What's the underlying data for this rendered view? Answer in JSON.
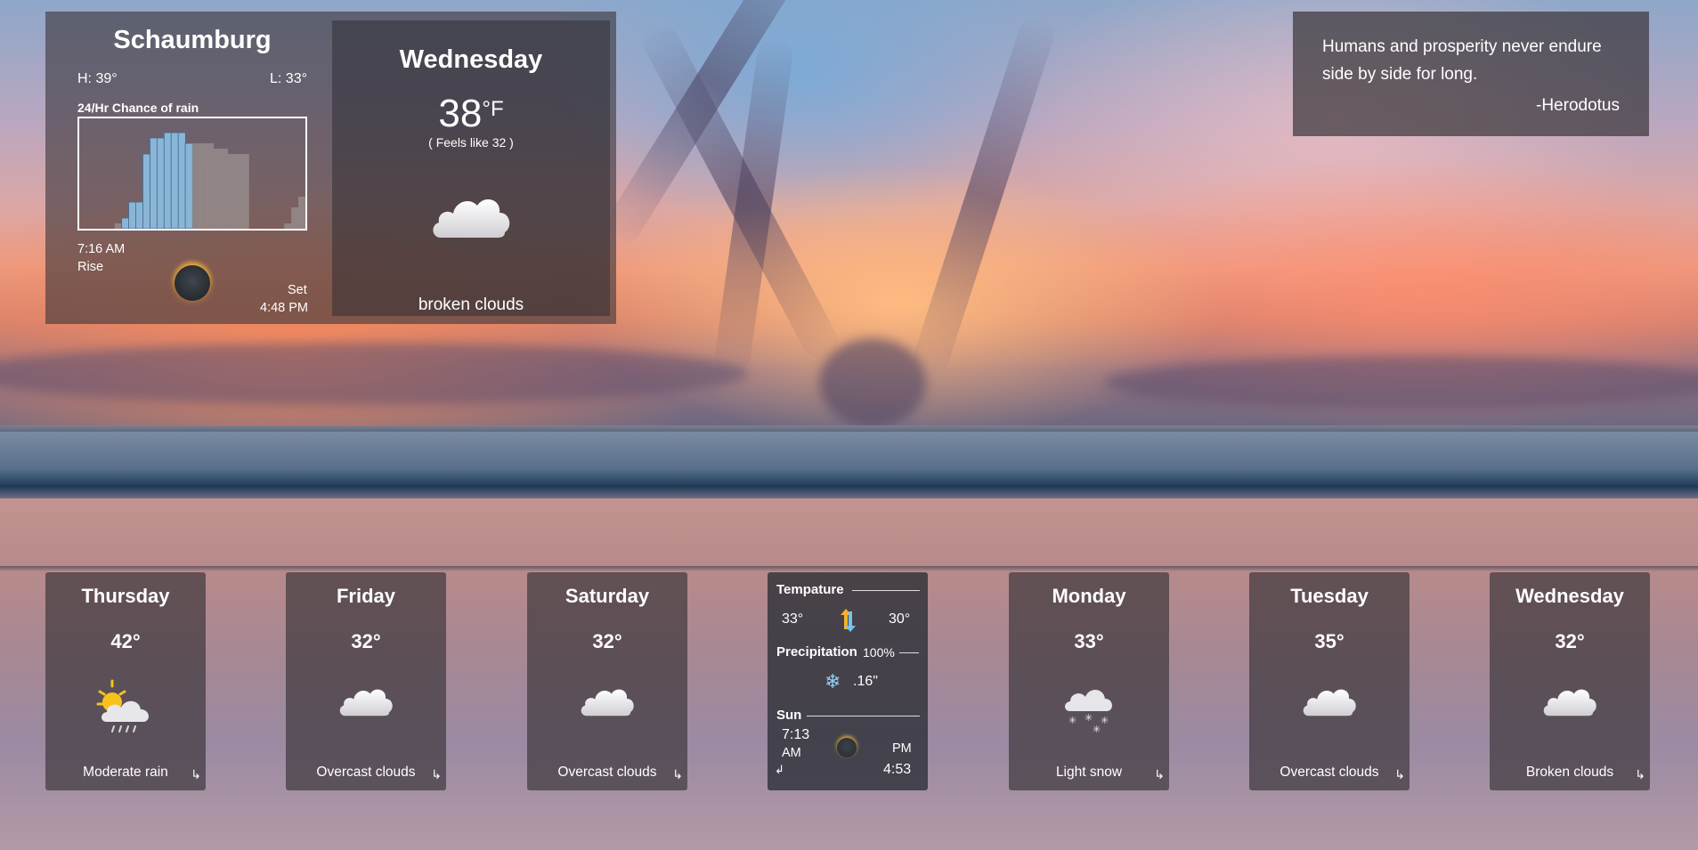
{
  "location": {
    "city": "Schaumburg",
    "high": "H: 39°",
    "low": "L: 33°"
  },
  "rain_chart": {
    "title": "24/Hr Chance of rain"
  },
  "chart_data": {
    "type": "bar",
    "title": "24/Hr Chance of rain",
    "values": [
      0,
      0,
      0,
      0,
      0,
      5,
      10,
      25,
      25,
      70,
      85,
      85,
      90,
      90,
      90,
      80,
      80,
      80,
      80,
      75,
      75,
      70,
      70,
      70,
      0,
      0,
      0,
      0,
      0,
      5,
      20,
      30
    ],
    "highlight_range": [
      6,
      15
    ],
    "ylim": [
      0,
      100
    ],
    "grid": false
  },
  "sun": {
    "rise_time": "7:16 AM",
    "rise_label": "Rise",
    "set_label": "Set",
    "set_time": "4:48 PM"
  },
  "today": {
    "day": "Wednesday",
    "temp": "38",
    "unit": "°F",
    "feels_like": "( Feels like 32 )",
    "description": "broken clouds",
    "icon": "cloud-icon"
  },
  "quote": {
    "text": "Humans and prosperity never endure side by side for long.",
    "author": "-Herodotus"
  },
  "forecast": [
    {
      "day": "Thursday",
      "temp": "42°",
      "description": "Moderate rain",
      "icon": "sun-rain-cloud-icon"
    },
    {
      "day": "Friday",
      "temp": "32°",
      "description": "Overcast clouds",
      "icon": "cloud-icon"
    },
    {
      "day": "Saturday",
      "temp": "32°",
      "description": "Overcast clouds",
      "icon": "cloud-icon"
    },
    {
      "day": "Monday",
      "temp": "33°",
      "description": "Light snow",
      "icon": "snow-cloud-icon"
    },
    {
      "day": "Tuesday",
      "temp": "35°",
      "description": "Overcast clouds",
      "icon": "cloud-icon"
    },
    {
      "day": "Wednesday",
      "temp": "32°",
      "description": "Broken clouds",
      "icon": "cloud-icon"
    }
  ],
  "detail": {
    "temperature_label": "Tempature",
    "temp_high": "33°",
    "temp_low": "30°",
    "precipitation_label": "Precipitation",
    "precipitation_chance": "100%",
    "precipitation_amount": ".16\"",
    "sun_label": "Sun",
    "sunrise_time": "7:13",
    "sunrise_period": "AM",
    "sunset_period": "PM",
    "sunset_time": "4:53"
  },
  "colors": {
    "panel": "#3c373c",
    "rain_bar_highlight": "#8ec4ea",
    "rain_bar": "#9a9090",
    "sun_glow": "#ffb93c"
  }
}
